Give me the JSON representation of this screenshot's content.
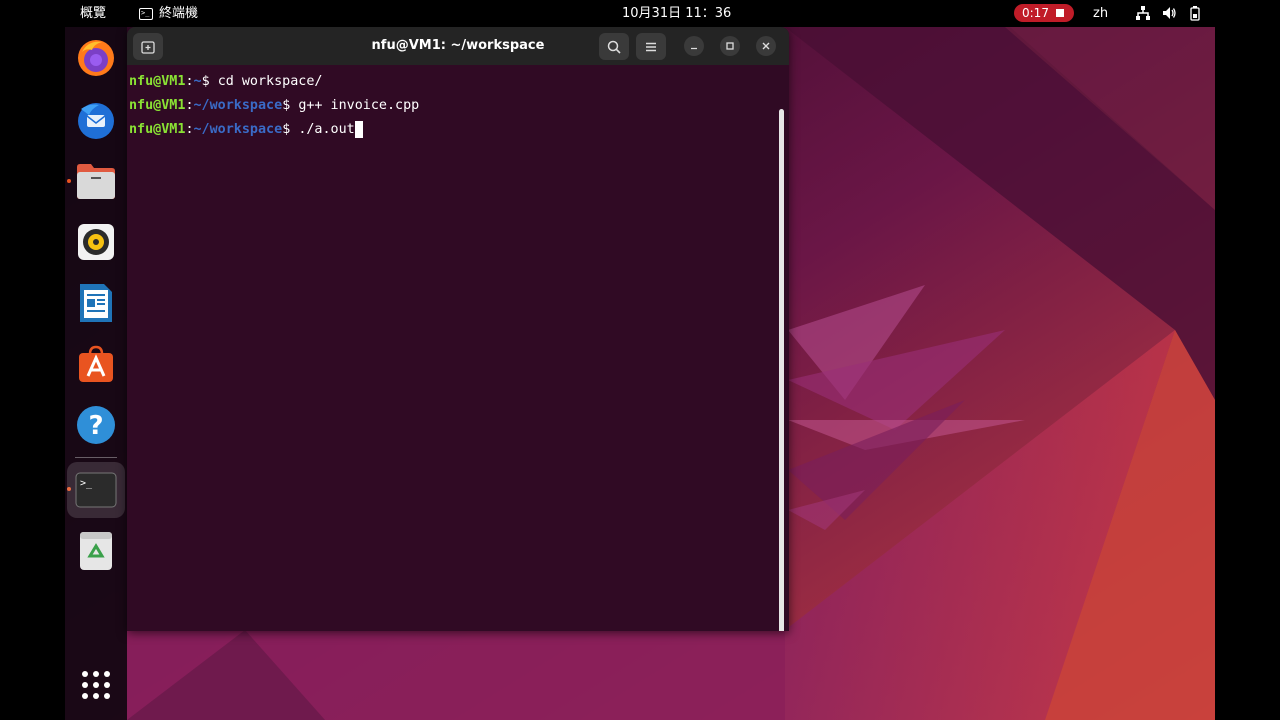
{
  "topbar": {
    "activities": "概覽",
    "app_name": "終端機",
    "clock": "10月31日 11：36",
    "recording_time": "0:17",
    "language": "zh"
  },
  "dock": {
    "items": [
      {
        "name": "Firefox",
        "icon": "firefox-icon"
      },
      {
        "name": "Thunderbird",
        "icon": "thunderbird-icon"
      },
      {
        "name": "Files",
        "icon": "files-icon"
      },
      {
        "name": "Rhythmbox",
        "icon": "rhythmbox-icon"
      },
      {
        "name": "LibreOffice Writer",
        "icon": "writer-icon"
      },
      {
        "name": "Ubuntu Software",
        "icon": "software-icon"
      },
      {
        "name": "Help",
        "icon": "help-icon"
      },
      {
        "name": "Terminal",
        "icon": "terminal-icon"
      },
      {
        "name": "Trash",
        "icon": "trash-icon"
      },
      {
        "name": "Show Applications",
        "icon": "app-grid-icon"
      }
    ]
  },
  "terminal": {
    "title": "nfu@VM1: ~/workspace",
    "lines": [
      {
        "user": "nfu@VM1",
        "sep": ":",
        "path": "~",
        "prompt": "$ ",
        "command": "cd workspace/"
      },
      {
        "user": "nfu@VM1",
        "sep": ":",
        "path": "~/workspace",
        "prompt": "$ ",
        "command": "g++ invoice.cpp"
      },
      {
        "user": "nfu@VM1",
        "sep": ":",
        "path": "~/workspace",
        "prompt": "$ ",
        "command": "./a.out"
      }
    ]
  },
  "colors": {
    "terminal_bg": "#300a24",
    "prompt_user": "#8ae234",
    "prompt_path": "#3a6bc7",
    "accent": "#e95420",
    "recording": "#c01c28"
  }
}
